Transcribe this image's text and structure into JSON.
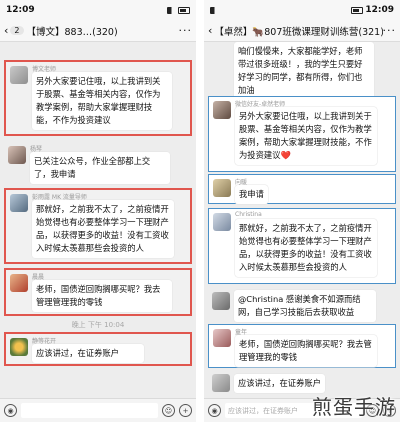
{
  "left": {
    "status_time": "12:09",
    "header_back_count": "2",
    "header_title": "【博文】883…(320)",
    "header_more": "···",
    "messages": [
      {
        "sender": "博文老师",
        "text": "另外大家要记住哦，以上我讲到关于股票、基金等相关内容，仅作为教学案例，帮助大家掌握理财技能，不作为投资建议"
      },
      {
        "sender": "杨琴",
        "text": "已关注公众号，作业全部都上交了，我申请"
      },
      {
        "sender": "彭雨露 MK 流量导师",
        "text": "那就好，之前我不太了，之前疫情开始觉得也有必要整体学习一下理财产品，以获得更多的收益！没有工资收入时候太羡慕那些会投资的人"
      },
      {
        "sender": "晨晨",
        "text": "老师，国债逆回购搁哪买呢？我去管理管理我的零钱"
      },
      {
        "sender": "静等花开",
        "text": "应该讲过，在证券账户"
      }
    ],
    "timestamp": "晚上 下午 10:04",
    "input_placeholder": ""
  },
  "right": {
    "status_time": "12:09",
    "header_title": "【卓然】🐂807班微课理财训练营(321)",
    "header_more": "···",
    "messages": [
      {
        "sender": "",
        "text": "咱们慢慢来，大家都能学好，老师带过很多班级！，我的学生只要好好学习的同学，都有所得，你们也加油"
      },
      {
        "sender": "微信好友-卓然老师",
        "text": "另外大家要记住哦，以上我讲到关于股票、基金等相关内容，仅作为教学案例，帮助大家掌握理财技能，不作为投资建议❤️"
      },
      {
        "sender": "向暖",
        "text": "我申请"
      },
      {
        "sender": "Christina",
        "text": "那就好，之前我不太了，之前疫情开始觉得也有必要整体学习一下理财产品，以获得更多的收益！没有工资收入时候太羡慕那些会投资的人"
      },
      {
        "sender": "",
        "text": "@Christina 感谢美食不如源而结网，自己学习技能后去获取收益"
      },
      {
        "sender": "童年",
        "text": "老师，国债逆回购搁哪买呢？我去管理管理我的零钱"
      },
      {
        "sender": "",
        "text": "应该讲过，在证券账户"
      }
    ],
    "input_placeholder": "应该讲过，在证券账户"
  },
  "watermark": "煎蛋手游"
}
